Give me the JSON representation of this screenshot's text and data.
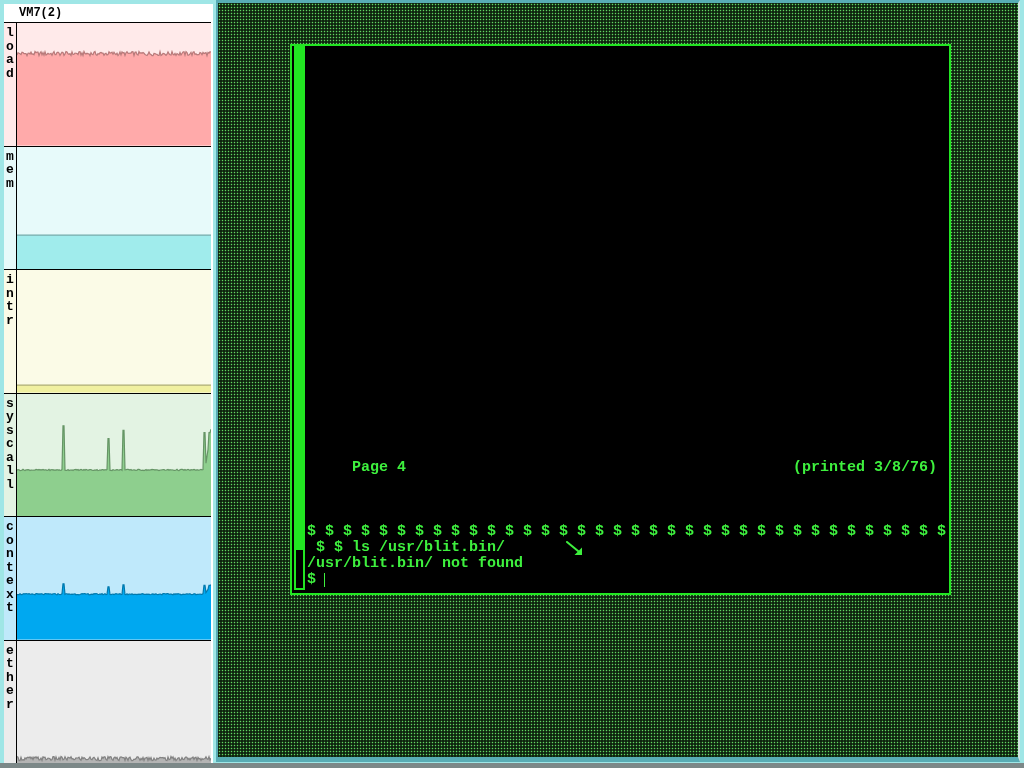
{
  "monitor": {
    "title": "VM7(2)",
    "panes": [
      {
        "label": "load",
        "kind": "noisy",
        "color": "#ffaaaa"
      },
      {
        "label": "mem",
        "kind": "flat",
        "color": "#a0ecec"
      },
      {
        "label": "intr",
        "kind": "flat",
        "color": "#f0f0a0"
      },
      {
        "label": "syscall",
        "kind": "spiky",
        "color": "#8ecf8e"
      },
      {
        "label": "context",
        "kind": "bumpy",
        "color": "#00a8f0"
      },
      {
        "label": "ether",
        "kind": "noisy",
        "color": "#b4b4b4"
      }
    ]
  },
  "terminal": {
    "header": {
      "left": "Page 4",
      "right": "(printed 3/8/76)"
    },
    "lines": [
      "$ $ $ $ $ $ $ $ $ $ $ $ $ $ $ $ $ $ $ $ $ $ $ $ $ $ $ $ $ $ $ $ $ $ $ $",
      " $ $ ls /usr/blit.bin/",
      "/usr/blit.bin/ not found",
      "$"
    ],
    "cursor_visible": true
  }
}
